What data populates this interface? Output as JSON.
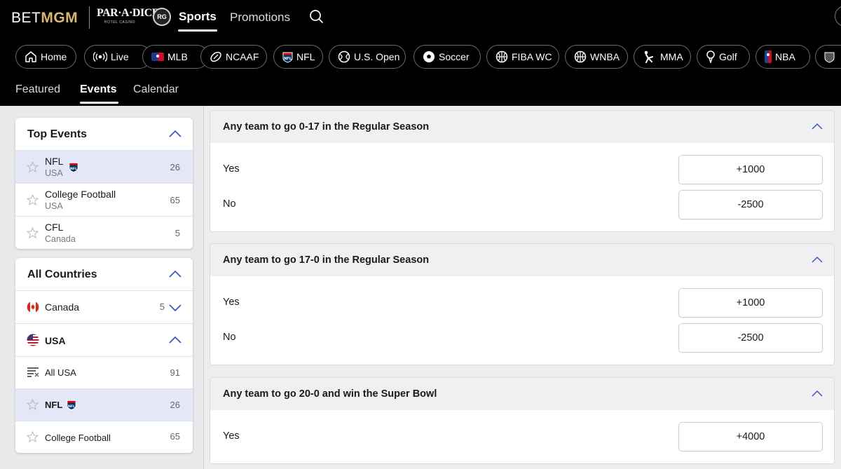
{
  "header": {
    "brand_part1": "BET",
    "brand_part2": "MGM",
    "partner_logo_big": "PAR·A·DICE",
    "partner_logo_small": "HOTEL CASINO",
    "rg_badge": "RG",
    "nav": {
      "sports": "Sports",
      "promotions": "Promotions"
    },
    "search_icon": "search-icon"
  },
  "chips": [
    {
      "label": "Home",
      "icon": "home-icon"
    },
    {
      "label": "Live",
      "icon": "live-icon"
    },
    {
      "label": "MLB",
      "icon": "mlb-icon"
    },
    {
      "label": "NCAAF",
      "icon": "football-icon"
    },
    {
      "label": "NFL",
      "icon": "nfl-icon"
    },
    {
      "label": "U.S. Open",
      "icon": "tennis-icon"
    },
    {
      "label": "Soccer",
      "icon": "soccer-icon"
    },
    {
      "label": "FIBA WC",
      "icon": "basketball-icon"
    },
    {
      "label": "WNBA",
      "icon": "basketball-icon"
    },
    {
      "label": "MMA",
      "icon": "mma-icon"
    },
    {
      "label": "Golf",
      "icon": "golf-icon"
    },
    {
      "label": "NBA",
      "icon": "nba-icon"
    }
  ],
  "subtabs": {
    "featured": "Featured",
    "events": "Events",
    "calendar": "Calendar"
  },
  "top_events": {
    "title": "Top Events",
    "items": [
      {
        "name": "NFL",
        "region": "USA",
        "count": "26"
      },
      {
        "name": "College Football",
        "region": "USA",
        "count": "65"
      },
      {
        "name": "CFL",
        "region": "Canada",
        "count": "5"
      }
    ]
  },
  "all_countries": {
    "title": "All Countries",
    "canada": {
      "name": "Canada",
      "count": "5"
    },
    "usa": {
      "name": "USA",
      "items": [
        {
          "name": "All USA",
          "count": "91"
        },
        {
          "name": "NFL",
          "count": "26"
        },
        {
          "name": "College Football",
          "count": "65"
        }
      ]
    }
  },
  "markets": [
    {
      "title": "Any team to go 0-17 in the Regular Season",
      "selections": [
        {
          "label": "Yes",
          "odds": "+1000"
        },
        {
          "label": "No",
          "odds": "-2500"
        }
      ]
    },
    {
      "title": "Any team to go 17-0 in the Regular Season",
      "selections": [
        {
          "label": "Yes",
          "odds": "+1000"
        },
        {
          "label": "No",
          "odds": "-2500"
        }
      ]
    },
    {
      "title": "Any team to go 20-0 and win the Super Bowl",
      "selections": [
        {
          "label": "Yes",
          "odds": "+4000"
        }
      ]
    }
  ],
  "colors": {
    "brand_gold": "#d7b873",
    "header_bg": "#000000",
    "selected_row": "#e4e7f7",
    "chevron": "#3b57c4"
  }
}
